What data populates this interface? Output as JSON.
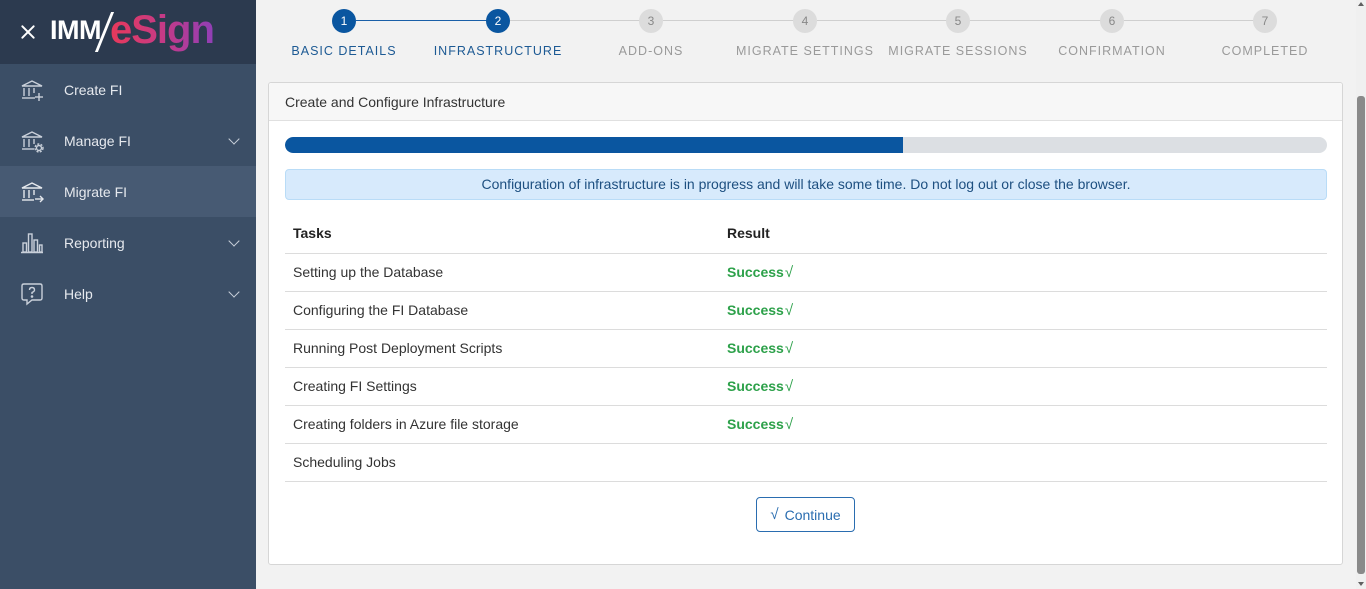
{
  "sidebar": {
    "logo": {
      "left": "IMM",
      "right": "eSign"
    },
    "items": [
      {
        "label": "Create FI",
        "icon": "bank-plus-icon"
      },
      {
        "label": "Manage FI",
        "icon": "bank-gear-icon"
      },
      {
        "label": "Migrate FI",
        "icon": "bank-arrow-icon"
      },
      {
        "label": "Reporting",
        "icon": "bar-chart-icon"
      },
      {
        "label": "Help",
        "icon": "question-bubble-icon"
      }
    ]
  },
  "stepper": {
    "steps": [
      {
        "number": "1",
        "label": "BASIC DETAILS"
      },
      {
        "number": "2",
        "label": "INFRASTRUCTURE"
      },
      {
        "number": "3",
        "label": "ADD-ONS"
      },
      {
        "number": "4",
        "label": "MIGRATE SETTINGS"
      },
      {
        "number": "5",
        "label": "MIGRATE SESSIONS"
      },
      {
        "number": "6",
        "label": "CONFIRMATION"
      },
      {
        "number": "7",
        "label": "COMPLETED"
      }
    ]
  },
  "card": {
    "title": "Create and Configure Infrastructure",
    "progress_fraction": 0.593,
    "alert": "Configuration of infrastructure is in progress and will take some time. Do not log out or close the browser.",
    "table": {
      "headers": [
        "Tasks",
        "Result"
      ],
      "rows": [
        {
          "task": "Setting up the Database",
          "result": "Success",
          "check": "√"
        },
        {
          "task": "Configuring the FI Database",
          "result": "Success",
          "check": "√"
        },
        {
          "task": "Running Post Deployment Scripts",
          "result": "Success",
          "check": "√"
        },
        {
          "task": "Creating FI Settings",
          "result": "Success",
          "check": "√"
        },
        {
          "task": "Creating folders in Azure file storage",
          "result": "Success",
          "check": "√"
        },
        {
          "task": "Scheduling Jobs",
          "result": "",
          "check": ""
        }
      ]
    },
    "continue_label": "Continue",
    "continue_check": "√"
  },
  "colors": {
    "sidebar_bg": "#3b4e66",
    "primary": "#0a56a0",
    "success": "#2da14a"
  }
}
